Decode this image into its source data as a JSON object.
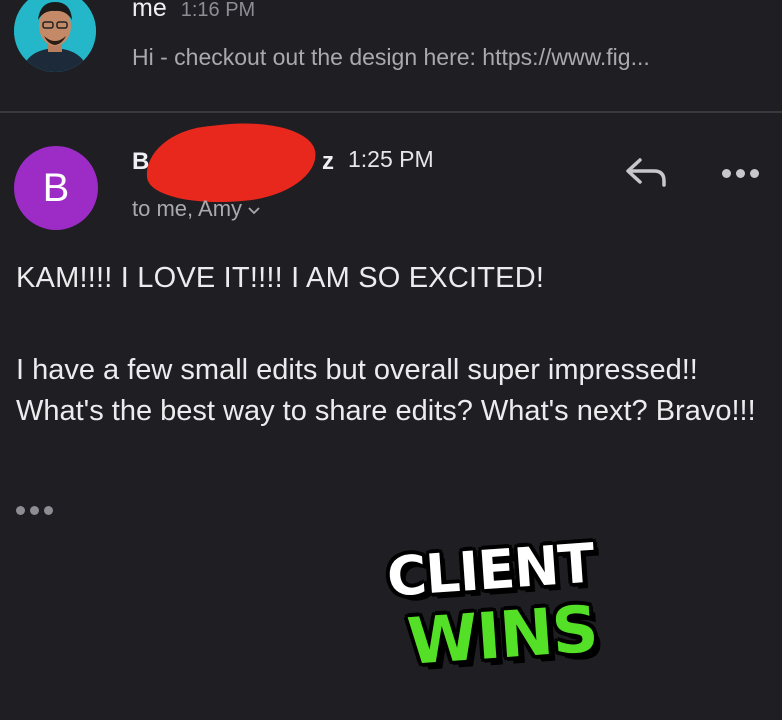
{
  "thread": {
    "first_message": {
      "sender": "me",
      "time": "1:16 PM",
      "preview": "Hi - checkout out the design here: https://www.fig...",
      "avatar_color": "#23b7c9"
    },
    "second_message": {
      "sender_initial": "B",
      "sender_start": "B",
      "sender_end": "z",
      "avatar_color": "#9d2bc6",
      "redaction_color": "#e8281d",
      "time": "1:25 PM",
      "recipients": "to me, Amy",
      "reply_icon": "reply-icon",
      "more_icon": "more-options-icon",
      "body_line1": "KAM!!!! I LOVE IT!!!! I AM SO EXCITED!",
      "body_paragraph": "I have a few small edits but overall super impressed!! What's the best way to share edits? What's next? Bravo!!!"
    }
  },
  "overlay": {
    "line1": "CLIENT",
    "line2": "WINS",
    "line1_color": "#ffffff",
    "line2_color": "#54e027"
  }
}
